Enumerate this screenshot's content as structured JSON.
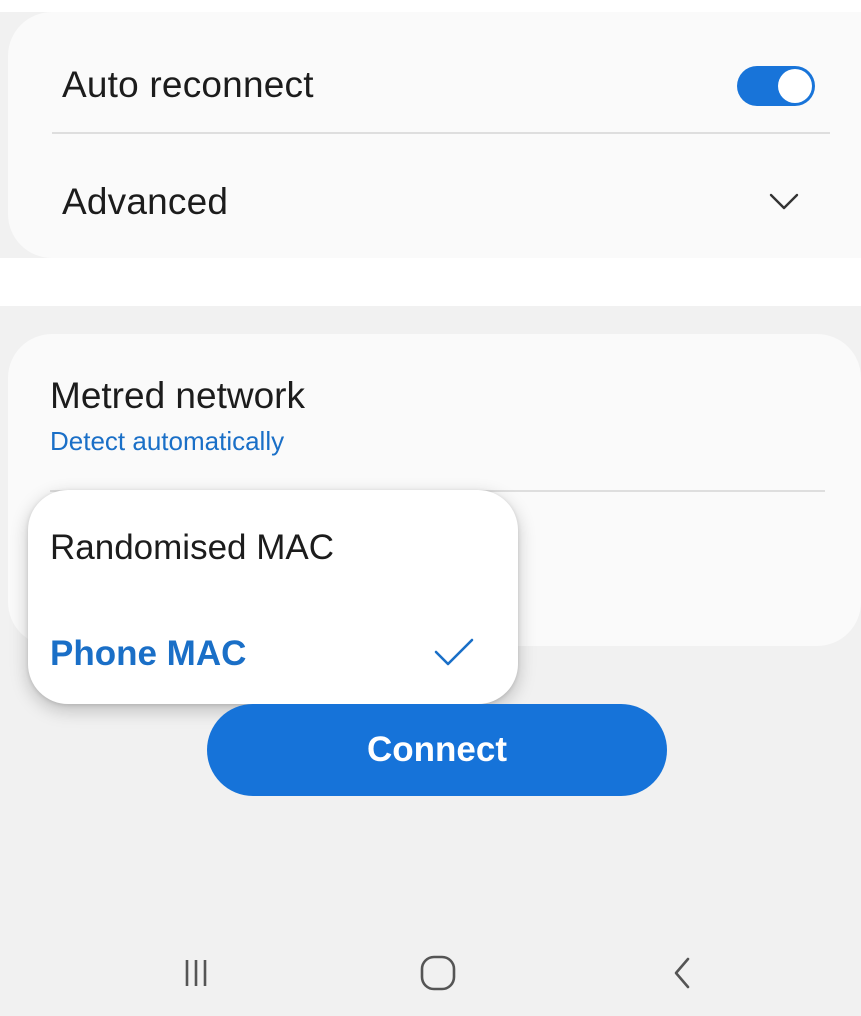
{
  "settings": {
    "auto_reconnect": {
      "label": "Auto reconnect",
      "enabled": true,
      "icon": "toggle-on-icon"
    },
    "advanced": {
      "label": "Advanced",
      "icon": "chevron-down-icon"
    },
    "metered_network": {
      "label": "Metred network",
      "value": "Detect automatically"
    }
  },
  "mac_dropdown": {
    "options": [
      {
        "label": "Randomised MAC",
        "selected": false
      },
      {
        "label": "Phone MAC",
        "selected": true
      }
    ],
    "selected_icon": "checkmark-icon"
  },
  "actions": {
    "connect_label": "Connect"
  },
  "navbar": {
    "recents_icon": "recents-icon",
    "home_icon": "home-icon",
    "back_icon": "back-icon"
  },
  "colors": {
    "accent": "#1673d9",
    "accent_text": "#1a6fc7",
    "background": "#f1f1f1",
    "card": "#fafafa"
  }
}
